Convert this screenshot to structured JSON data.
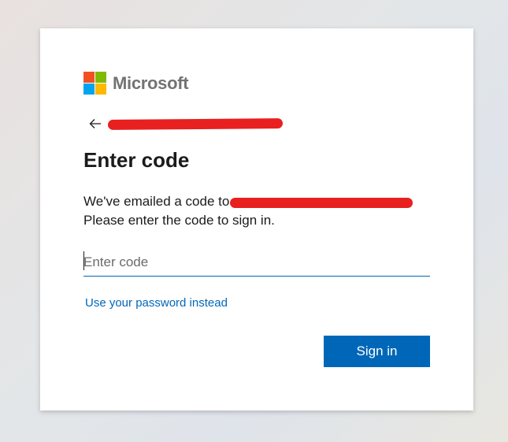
{
  "brand": {
    "name": "Microsoft",
    "logo_colors": [
      "#f25022",
      "#7fba00",
      "#00a4ef",
      "#ffb900"
    ]
  },
  "header": {
    "back_icon": "arrow-left-icon"
  },
  "main": {
    "title": "Enter code",
    "description_prefix": "We've emailed a code to",
    "description_line2": "Please enter the code to sign in.",
    "code_input": {
      "placeholder": "Enter code",
      "value": ""
    },
    "password_link": "Use your password instead",
    "signin_label": "Sign in"
  },
  "colors": {
    "accent": "#0067b8",
    "redaction": "#e8201f"
  }
}
